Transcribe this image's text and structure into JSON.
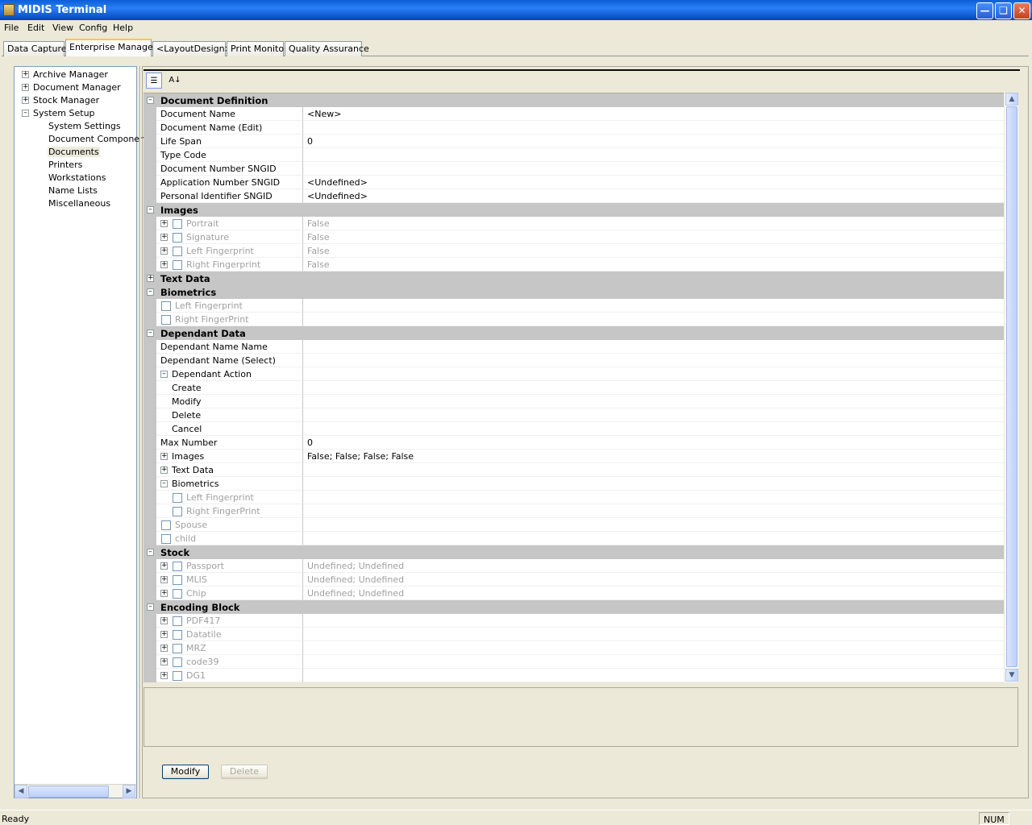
{
  "window": {
    "title": "MIDIS Terminal"
  },
  "menu": [
    "File",
    "Edit",
    "View",
    "Config",
    "Help"
  ],
  "tabs": [
    "Data Capture",
    "Enterprise Manager",
    "<LayoutDesign>",
    "Print Monitor",
    "Quality Assurance"
  ],
  "active_tab": "Enterprise Manager",
  "tree": {
    "roots": [
      "Archive Manager",
      "Document Manager",
      "Stock Manager",
      "System Setup"
    ],
    "children": [
      "System Settings",
      "Document Component",
      "Documents",
      "Printers",
      "Workstations",
      "Name Lists",
      "Miscellaneous"
    ],
    "selected": "Documents"
  },
  "grid": {
    "categories": {
      "document_definition": "Document Definition",
      "images": "Images",
      "text_data": "Text Data",
      "biometrics": "Biometrics",
      "dependant_data": "Dependant Data",
      "stock": "Stock",
      "encoding_block": "Encoding Block"
    },
    "rows": [
      {
        "name": "Document Name",
        "value": "<New>"
      },
      {
        "name": "Document Name (Edit)",
        "value": ""
      },
      {
        "name": "Life Span",
        "value": "0"
      },
      {
        "name": "Type Code",
        "value": ""
      },
      {
        "name": "Document Number SNGID",
        "value": ""
      },
      {
        "name": "Application Number SNGID",
        "value": "<Undefined>"
      },
      {
        "name": "Personal Identifier SNGID",
        "value": "<Undefined>"
      },
      {
        "name": "Portrait",
        "value": "False"
      },
      {
        "name": "Signature",
        "value": "False"
      },
      {
        "name": "Left Fingerprint",
        "value": "False"
      },
      {
        "name": "Right Fingerprint",
        "value": "False"
      },
      {
        "name": "Left Fingerprint",
        "value": ""
      },
      {
        "name": "Right FingerPrint",
        "value": ""
      },
      {
        "name": "Dependant Name Name",
        "value": ""
      },
      {
        "name": "Dependant Name (Select)",
        "value": ""
      },
      {
        "name": "Dependant Action",
        "value": ""
      },
      {
        "name": "Create",
        "value": ""
      },
      {
        "name": "Modify",
        "value": ""
      },
      {
        "name": "Delete",
        "value": ""
      },
      {
        "name": "Cancel",
        "value": ""
      },
      {
        "name": "Max Number",
        "value": "0"
      },
      {
        "name": "Images",
        "value": "False; False; False; False"
      },
      {
        "name": "Text Data",
        "value": ""
      },
      {
        "name": "Biometrics",
        "value": ""
      },
      {
        "name": "Left Fingerprint",
        "value": ""
      },
      {
        "name": "Right FingerPrint",
        "value": ""
      },
      {
        "name": "Spouse",
        "value": ""
      },
      {
        "name": "child",
        "value": ""
      },
      {
        "name": "Passport",
        "value": "Undefined; Undefined"
      },
      {
        "name": "MLIS",
        "value": "Undefined; Undefined"
      },
      {
        "name": "Chip",
        "value": "Undefined; Undefined"
      },
      {
        "name": "PDF417",
        "value": ""
      },
      {
        "name": "Datatile",
        "value": ""
      },
      {
        "name": "MRZ",
        "value": ""
      },
      {
        "name": "code39",
        "value": ""
      },
      {
        "name": "DG1",
        "value": ""
      }
    ]
  },
  "buttons": {
    "modify": "Modify",
    "delete": "Delete"
  },
  "status": {
    "text": "Ready",
    "num": "NUM"
  },
  "colors": {
    "title_bar": "#0a5fd8",
    "category_bg": "#c6c6c6",
    "window_bg": "#ece9d8"
  },
  "icons": [
    "app-icon",
    "minimize-icon",
    "restore-icon",
    "close-icon",
    "categorized-icon",
    "alphabetical-icon",
    "expand-icon",
    "collapse-icon",
    "checkbox-icon"
  ]
}
